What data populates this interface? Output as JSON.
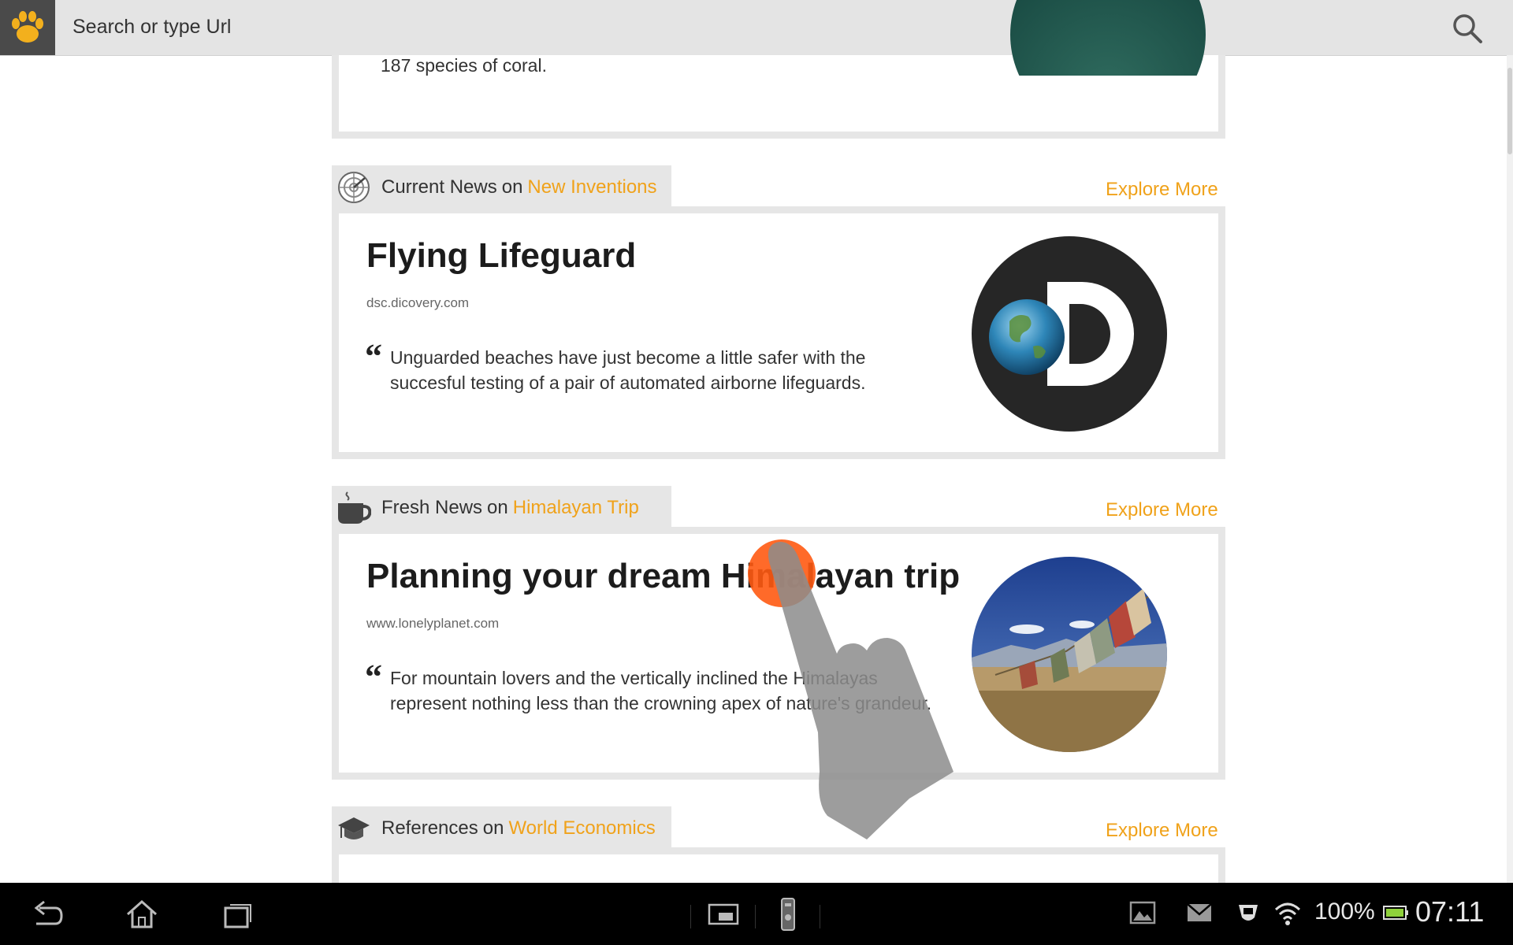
{
  "browser": {
    "url_placeholder": "Search or type Url",
    "logo_icon": "paw-icon",
    "search_icon": "search-icon",
    "accent_color": "#f0a21a"
  },
  "previous_card": {
    "partial_text": "187 species of coral."
  },
  "sections": [
    {
      "icon": "radar-icon",
      "category": "Current News",
      "on": "on",
      "topic": "New Inventions",
      "explore": "Explore More",
      "title": "Flying Lifeguard",
      "source": "dsc.dicovery.com",
      "quote": "Unguarded beaches have just become a little safer with the succesful testing of a pair of automated airborne lifeguards.",
      "image": "discovery-logo"
    },
    {
      "icon": "coffee-cup-icon",
      "category": "Fresh News",
      "on": "on",
      "topic": "Himalayan Trip",
      "explore": "Explore More",
      "title": "Planning your dream Himalayan trip",
      "source": "www.lonelyplanet.com",
      "quote": "For mountain lovers and the vertically inclined the Himalayas represent nothing less than the crowning apex of nature's grandeur.",
      "image": "prayer-flags-photo"
    },
    {
      "icon": "graduation-cap-icon",
      "category": "References",
      "on": "on",
      "topic": "World Economics",
      "explore": "Explore More"
    }
  ],
  "quote_mark": "“",
  "status_bar": {
    "battery": "100%",
    "time": "07:11"
  }
}
